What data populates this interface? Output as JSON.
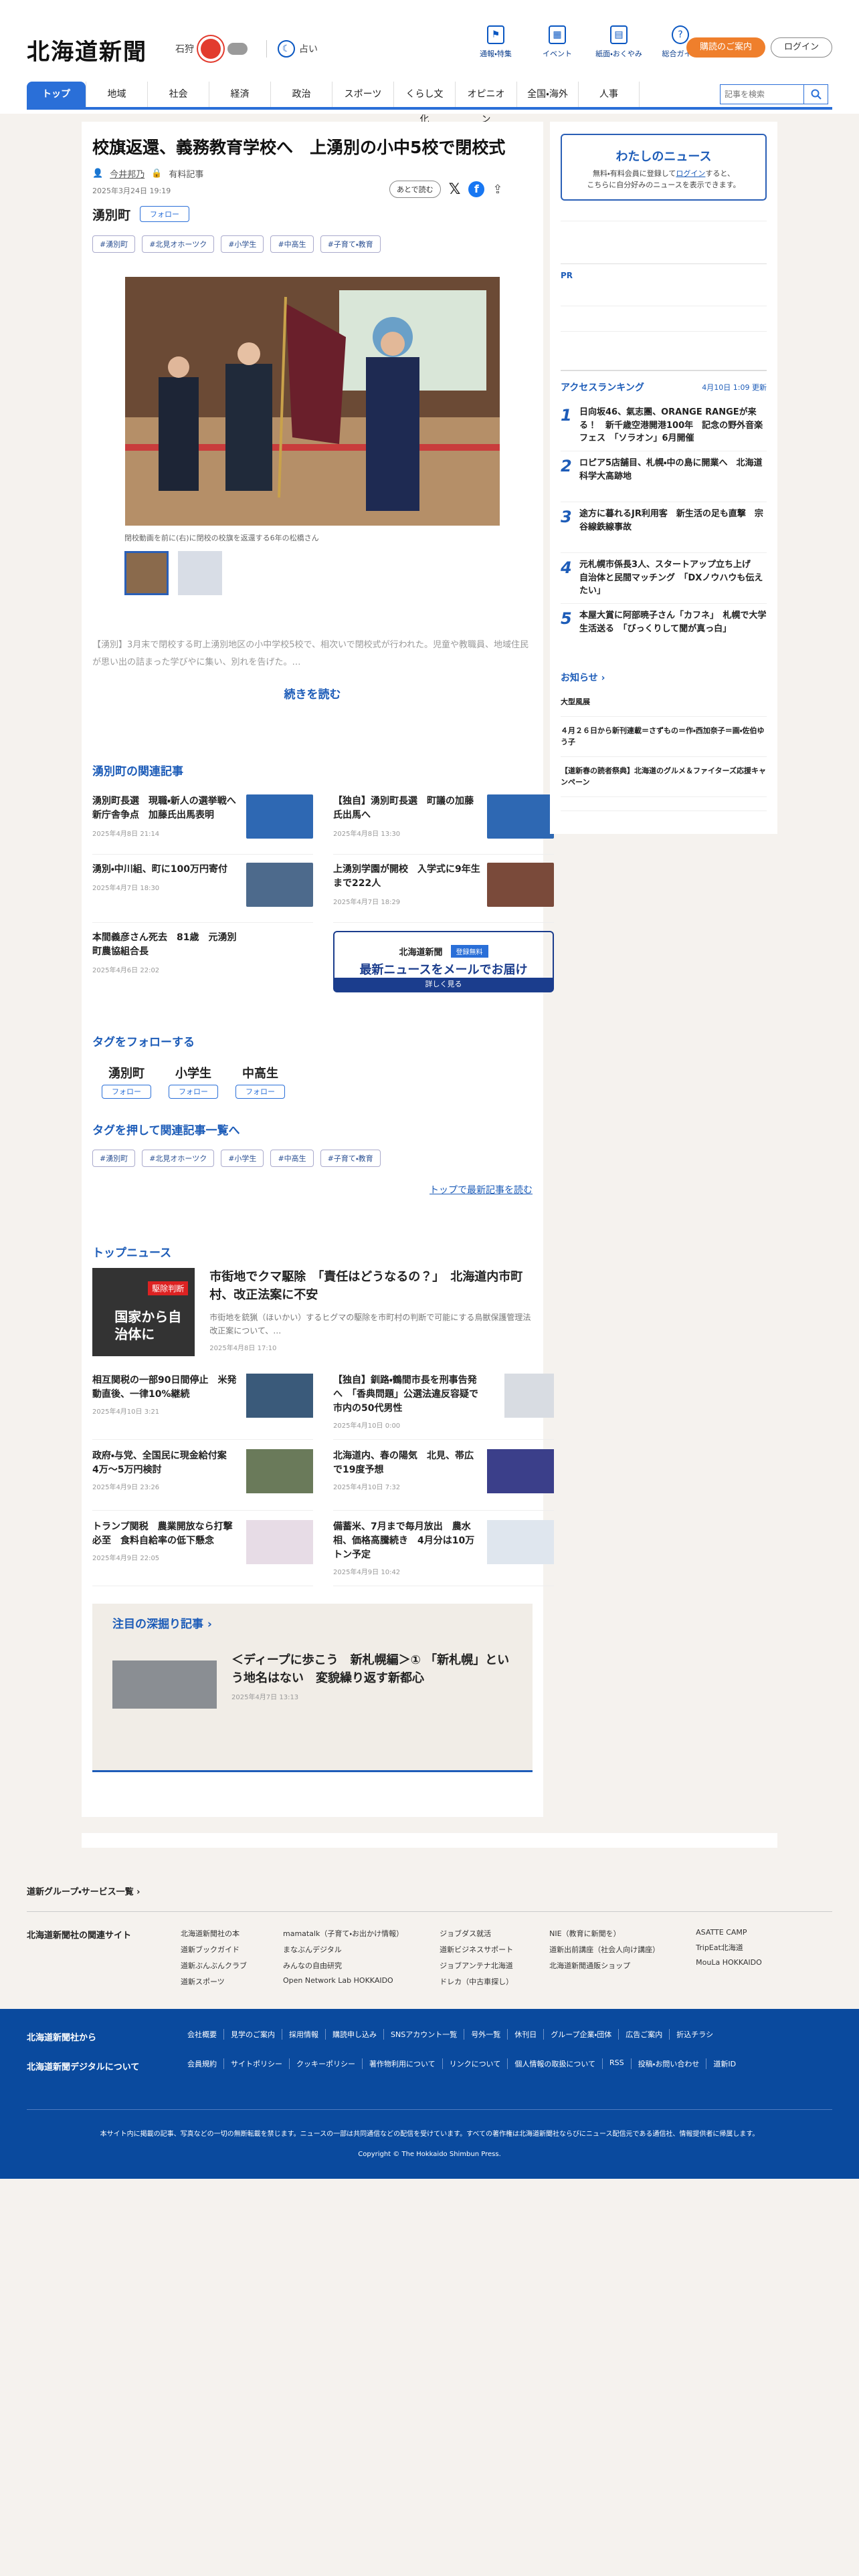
{
  "header": {
    "logo": "北海道新聞",
    "city": "石狩",
    "uranai": "占い",
    "top_nav": [
      {
        "label": "通報・特集",
        "icon": "flag-icon"
      },
      {
        "label": "イベント",
        "icon": "calendar-icon"
      },
      {
        "label": "紙面・おくやみ",
        "icon": "newspaper-icon"
      },
      {
        "label": "総合ガイド",
        "icon": "help-icon"
      }
    ],
    "subscribe": "購読のご案内",
    "login": "ログイン"
  },
  "menu": [
    "トップ",
    "地域",
    "社会",
    "経済",
    "政治",
    "スポーツ",
    "くらし文化",
    "オピニオン",
    "全国・海外",
    "人事"
  ],
  "search": {
    "placeholder": "記事を検索"
  },
  "article": {
    "title": "校旗返還、義務教育学校へ　上湧別の小中5校で閉校式",
    "author": "今井邦乃",
    "paid": "有料記事",
    "date": "2025年3月24日 19:19",
    "later": "あとで読む",
    "place": "湧別町",
    "follow": "フォロー",
    "tags": [
      "#湧別町",
      "#北見オホーツク",
      "#小学生",
      "#中高生",
      "#子育て・教育"
    ],
    "caption": "閉校動画を前に(右)に閉校の校旗を返還する6年の松橋さん",
    "lead": "【湧別】3月末で閉校する町上湧別地区の小中学校5校で、相次いで閉校式が行われた。児童や教職員、地域住民が思い出の詰まった学びやに集い、別れを告げた。…",
    "more": "続きを読む"
  },
  "related": {
    "title": "湧別町の関連記事",
    "items": [
      {
        "title": "湧別町長選　現職・新人の選挙戦へ　新庁舎争点　加藤氏出馬表明",
        "date": "2025年4月8日 21:14"
      },
      {
        "title": "【独自】湧別町長選　町議の加藤氏出馬へ",
        "date": "2025年4月8日 13:30"
      },
      {
        "title": "湧別・中川組、町に100万円寄付",
        "date": "2025年4月7日 18:30"
      },
      {
        "title": "上湧別学園が開校　入学式に9年生まで222人",
        "date": "2025年4月7日 18:29"
      },
      {
        "title": "本間義彦さん死去　81歳　元湧別町農協組合長",
        "date": "2025年4月6日 22:02"
      }
    ],
    "banner_logo": "北海道新聞",
    "banner_badge": "登録無料",
    "banner_title": "最新ニュースをメールでお届け",
    "banner_cta": "詳しく見る"
  },
  "tag_follow": {
    "title": "タグをフォローする",
    "items": [
      "湧別町",
      "小学生",
      "中高生"
    ],
    "btn": "フォロー"
  },
  "tag_related": {
    "title": "タグを押して関連記事一覧へ",
    "items": [
      "#湧別町",
      "#北見オホーツク",
      "#小学生",
      "#中高生",
      "#子育て・教育"
    ],
    "link": "トップで最新記事を読む"
  },
  "top_news": {
    "title": "トップニュース",
    "lead": {
      "title": "市街地でクマ駆除　「責任はどうなるの？」　北海道内市町村、改正法案に不安",
      "summary": "市街地を銃猟（ほいかい）するヒグマの駆除を市町村の判断で可能にする鳥獣保護管理法改正案について、…",
      "date": "2025年4月8日 17:10",
      "img_text1": "駆除判断",
      "img_text2": "国家から自治体に"
    },
    "items": [
      {
        "title": "相互関税の一部90日間停止　米発動直後、一律10%継続",
        "date": "2025年4月10日 3:21"
      },
      {
        "title": "【独自】釧路・鶴間市長を刑事告発へ　「香典問題」公選法違反容疑で　市内の50代男性",
        "date": "2025年4月10日 0:00"
      },
      {
        "title": "政府・与党、全国民に現金給付案　4万～5万円検討",
        "date": "2025年4月9日 23:26"
      },
      {
        "title": "北海道内、春の陽気　北見、帯広で19度予想",
        "date": "2025年4月10日 7:32"
      },
      {
        "title": "トランプ関税　農業開放なら打撃必至　食料自給率の低下懸念",
        "date": "2025年4月9日 22:05"
      },
      {
        "title": "備蓄米、7月まで毎月放出　農水相、価格高騰続き　4月分は10万トン予定",
        "date": "2025年4月9日 10:42"
      }
    ]
  },
  "deep": {
    "title": "注目の深掘り記事",
    "article": "＜ディープに歩こう　新札幌編＞① 「新札幌」という地名はない　変貌繰り返す新都心",
    "date": "2025年4月7日 13:13"
  },
  "sidebar": {
    "mynews_title": "わたしのニュース",
    "mynews_text1": "無料・有料会員に登録して",
    "mynews_link": "ログイン",
    "mynews_text2": "すると、",
    "mynews_text3": "こちらに自分好みのニュースを表示できます。",
    "pr": "PR",
    "ranking_title": "アクセスランキング",
    "ranking_updated": "4月10日 1:09 更新",
    "ranking": [
      {
        "n": "1",
        "title": "日向坂46、氣志團、ORANGE RANGEが来る！　新千歳空港開港100年　記念の野外音楽フェス　「ソラオン」6月開催"
      },
      {
        "n": "2",
        "title": "ロピア5店舗目、札幌・中の島に開業へ　北海道科学大高跡地"
      },
      {
        "n": "3",
        "title": "途方に暮れるJR利用客　新生活の足も直撃　宗谷線鉄線事故"
      },
      {
        "n": "4",
        "title": "元札幌市係長3人、スタートアップ立ち上げ　自治体と民間マッチング　「DXノウハウも伝えたい」"
      },
      {
        "n": "5",
        "title": "本屋大賞に阿部暁子さん「カフネ」　札幌で大学生活送る　「びっくりして聞が真っ白」"
      }
    ],
    "oshirase_title": "お知らせ",
    "oshirase": [
      "大型風展",
      "４月２６日から新刊連載＝さずもの＝作・西加奈子＝画・佐伯ゆう子",
      "【道新春の読者祭典】北海道のグルメ＆ファイターズ応援キャンペーン"
    ]
  },
  "footer": {
    "group": "道新グループ・サービス一覧",
    "related_sites": "北海道新聞社の関連サイト",
    "sites": [
      [
        "北海道新聞社の本",
        "道新ブックガイド",
        "道新ぶんぶんクラブ",
        "道新スポーツ"
      ],
      [
        "mamatalk（子育て・お出かけ情報）",
        "まなぶんデジタル",
        "みんなの自由研究",
        "Open Network Lab HOKKAIDO"
      ],
      [
        "ジョブダス就活",
        "道新ビジネスサポート",
        "ジョブアンテナ北海道",
        "ドレカ（中古車探し）"
      ],
      [
        "NIE（教育に新聞を）",
        "道新出前講座（社会人向け講座）",
        "北海道新聞通販ショップ"
      ],
      [
        "ASATTE CAMP",
        "TripEat北海道",
        "MouLa HOKKAIDO"
      ]
    ],
    "f1": "北海道新聞社から",
    "f2": "北海道新聞デジタルについて",
    "links1": [
      "会社概要",
      "見学のご案内",
      "採用情報",
      "購読申し込み",
      "SNSアカウント一覧",
      "号外一覧",
      "休刊日",
      "グループ企業・団体",
      "広告ご案内",
      "折込チラシ"
    ],
    "links2": [
      "会員規約",
      "サイトポリシー",
      "クッキーポリシー",
      "著作物利用について",
      "リンクについて",
      "個人情報の取扱について",
      "RSS",
      "投稿・お問い合わせ",
      "道新ID"
    ],
    "note": "本サイト内に掲載の記事、写真などの一切の無断転載を禁じます。ニュースの一部は共同通信などの配信を受けています。すべての著作権は北海道新聞社ならびにニュース配信元である通信社、情報提供者に帰属します。",
    "copyright": "Copyright © The Hokkaido Shimbun Press."
  }
}
